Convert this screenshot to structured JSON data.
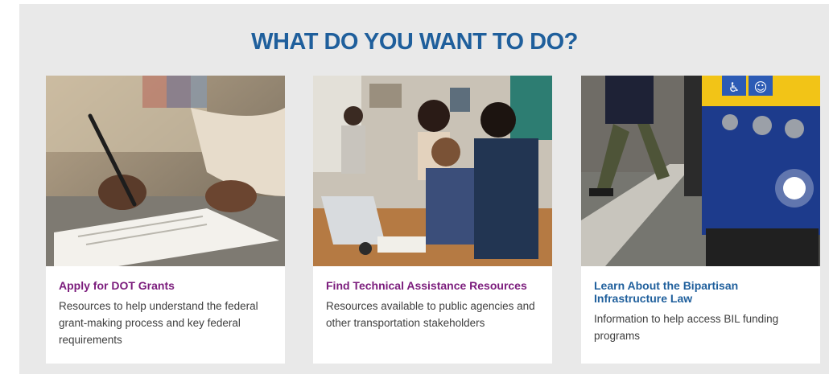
{
  "heading": "WHAT DO YOU WANT TO DO?",
  "colors": {
    "heading": "#1f5f9c",
    "visited_link": "#7b1c7c",
    "link": "#1f5f9c",
    "panel_bg": "#e9e9e9"
  },
  "cards": [
    {
      "image": "signing-documents-photo",
      "title": "Apply for DOT Grants",
      "description": "Resources to help understand the federal grant-making process and key federal requirements"
    },
    {
      "image": "team-at-laptop-photo",
      "title": "Find Technical Assistance Resources",
      "description": "Resources available to public agencies and other transportation stakeholders"
    },
    {
      "image": "accessible-bus-photo",
      "title": "Learn About the Bipartisan Infrastructure Law",
      "description": "Information to help access BIL funding programs"
    }
  ]
}
